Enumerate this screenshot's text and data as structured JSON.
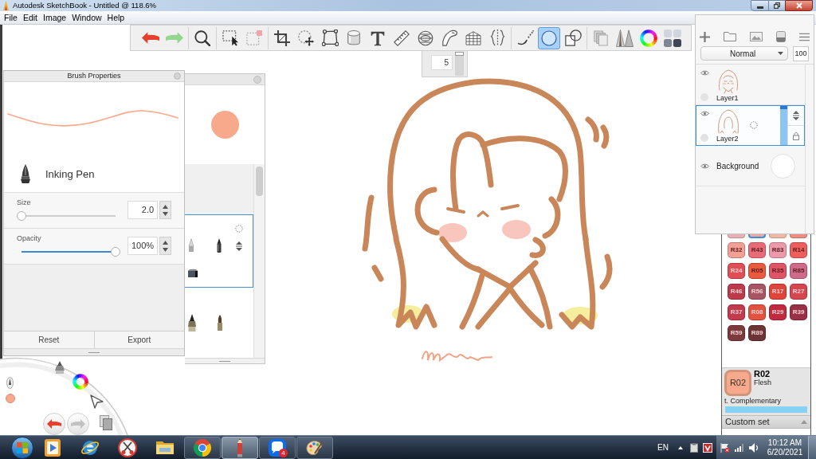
{
  "window": {
    "title": "Autodesk SketchBook - Untitled @ 118.6%"
  },
  "menu": [
    "File",
    "Edit",
    "Image",
    "Window",
    "Help"
  ],
  "toolbar": {
    "groups": [
      [
        {
          "kind": "undo",
          "selected": false
        },
        {
          "kind": "redo",
          "selected": false
        }
      ],
      [
        {
          "kind": "zoom",
          "selected": false
        }
      ],
      [
        {
          "kind": "select",
          "selected": false
        },
        {
          "kind": "crop-select",
          "selected": false
        }
      ],
      [
        {
          "kind": "crop",
          "selected": false
        },
        {
          "kind": "transform",
          "selected": false
        },
        {
          "kind": "distort",
          "selected": false
        },
        {
          "kind": "fill",
          "selected": false
        },
        {
          "kind": "text",
          "selected": false
        },
        {
          "kind": "ruler",
          "selected": false
        },
        {
          "kind": "ellipse-guide",
          "selected": false
        },
        {
          "kind": "french-curve",
          "selected": false
        },
        {
          "kind": "perspective",
          "selected": false
        },
        {
          "kind": "symmetry",
          "selected": false
        }
      ],
      [
        {
          "kind": "stroke",
          "selected": false
        },
        {
          "kind": "ellipse",
          "selected": true
        },
        {
          "kind": "shape",
          "selected": false
        }
      ],
      [
        {
          "kind": "copy",
          "selected": false
        },
        {
          "kind": "brushes",
          "selected": false
        },
        {
          "kind": "color-wheel",
          "selected": false
        },
        {
          "kind": "copic",
          "selected": false
        }
      ]
    ]
  },
  "brush_size_popup": {
    "value": "5",
    "level": 1
  },
  "brush_properties": {
    "title": "Brush Properties",
    "brush_name": "Inking Pen",
    "sliders": [
      {
        "label": "Size",
        "value": "2.0",
        "level": 0
      },
      {
        "label": "Opacity",
        "value": "100%",
        "level": 1
      }
    ],
    "buttons": [
      "Reset",
      "Export"
    ]
  },
  "layers_panel": {
    "blend_mode": "Normal",
    "opacity": "100",
    "layers": [
      {
        "name": "Layer1",
        "kind": "paint",
        "visible": true,
        "selected": false
      },
      {
        "name": "Layer2",
        "kind": "paint",
        "visible": true,
        "selected": true
      },
      {
        "name": "Background",
        "kind": "background",
        "visible": true,
        "selected": false
      }
    ]
  },
  "color_palette": {
    "top_row": [
      {
        "color": "#e8b2b4",
        "selected": false
      },
      {
        "color": "#f4a89c",
        "selected": true
      },
      {
        "color": "#f1b9a5",
        "selected": false
      },
      {
        "color": "#ef8e7e",
        "selected": false
      }
    ],
    "swatches": [
      {
        "label": "R32",
        "color": "#f2a096",
        "selected": false
      },
      {
        "label": "R43",
        "color": "#ea6b78",
        "selected": false
      },
      {
        "label": "R83",
        "color": "#ec9aaa",
        "selected": false
      },
      {
        "label": "R14",
        "color": "#ec5f5c",
        "selected": false
      },
      {
        "label": "R24",
        "color": "#df4f55",
        "selected": false
      },
      {
        "label": "R05",
        "color": "#ea5a3e",
        "selected": false
      },
      {
        "label": "R35",
        "color": "#df5565",
        "selected": false
      },
      {
        "label": "R85",
        "color": "#cf6a8a",
        "selected": false
      },
      {
        "label": "R46",
        "color": "#bc3a4a",
        "selected": false
      },
      {
        "label": "R56",
        "color": "#a65565",
        "selected": false
      },
      {
        "label": "R17",
        "color": "#e0453c",
        "selected": false
      },
      {
        "label": "R27",
        "color": "#d4474f",
        "selected": false
      },
      {
        "label": "R37",
        "color": "#c23a4c",
        "selected": false
      },
      {
        "label": "R08",
        "color": "#e2533f",
        "selected": false
      },
      {
        "label": "R29",
        "color": "#c42a3f",
        "selected": false
      },
      {
        "label": "R39",
        "color": "#9a3045",
        "selected": false
      },
      {
        "label": "R59",
        "color": "#7c3a3c",
        "selected": false
      },
      {
        "label": "R89",
        "color": "#6c3434",
        "selected": false
      }
    ],
    "current": {
      "swatch_label": "R02",
      "code": "R02",
      "name": "Flesh",
      "color": "#f9a98b"
    },
    "complementary": "t. Complementary",
    "set_name": "Custom set"
  },
  "taskbar": {
    "apps": [
      {
        "kind": "media-player",
        "running": false,
        "active": false
      },
      {
        "kind": "browser",
        "running": false,
        "active": false
      },
      {
        "kind": "snipping",
        "running": false,
        "active": false
      },
      {
        "kind": "file-explorer",
        "running": false,
        "active": false
      },
      {
        "kind": "chrome",
        "running": true,
        "active": false
      },
      {
        "kind": "sketchbook",
        "running": true,
        "active": true
      },
      {
        "kind": "chat",
        "running": true,
        "active": false,
        "badge": "4"
      },
      {
        "kind": "paint",
        "running": true,
        "active": false
      }
    ],
    "language": "EN",
    "time": "10:12 AM",
    "date": "6/20/2021"
  }
}
